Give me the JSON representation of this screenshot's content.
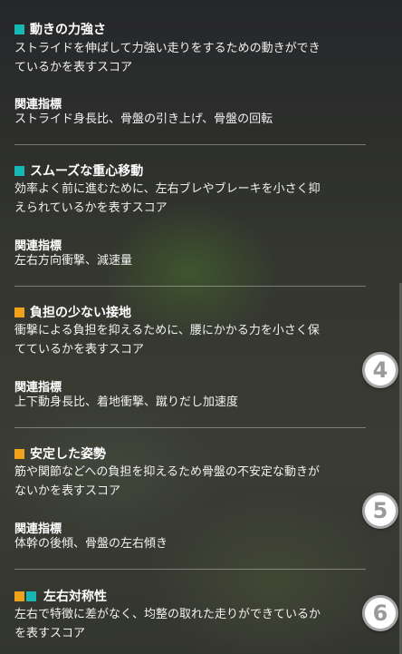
{
  "sections": [
    {
      "title": "動きの力強さ",
      "description_lines": [
        "ストライドを伸ばして力強い走りをするための動きができ",
        "ているかを表すスコア"
      ],
      "related_label": "関連指標",
      "related_metrics": "ストライド身長比、骨盤の引き上げ、骨盤の回転"
    },
    {
      "title": "スムーズな重心移動",
      "description_lines": [
        "効率よく前に進むために、左右ブレやブレーキを小さく抑",
        "えられているかを表すスコア"
      ],
      "related_label": "関連指標",
      "related_metrics": "左右方向衝撃、減速量"
    },
    {
      "title": "負担の少ない接地",
      "description_lines": [
        "衝撃による負担を抑えるために、腰にかかる力を小さく保",
        "てているかを表すスコア"
      ],
      "related_label": "関連指標",
      "related_metrics": "上下動身長比、着地衝撃、蹴りだし加速度"
    },
    {
      "title": "安定した姿勢",
      "description_lines": [
        "筋や関節などへの負担を抑えるため骨盤の不安定な動きが",
        "ないかを表すスコア"
      ],
      "related_label": "関連指標",
      "related_metrics": "体幹の後傾、骨盤の左右傾き"
    },
    {
      "title": "左右対称性",
      "description_lines": [
        "左右で特徴に差がなく、均整の取れた走りができているか",
        "を表すスコア"
      ]
    }
  ],
  "markers": [
    "4",
    "5",
    "6"
  ],
  "colors": {
    "teal": "#17b7b4",
    "orange": "#f0a21c"
  }
}
